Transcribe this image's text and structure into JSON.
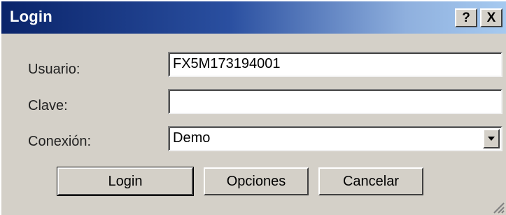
{
  "window": {
    "title": "Login",
    "help_label": "?",
    "close_label": "X"
  },
  "form": {
    "usuario_label": "Usuario:",
    "usuario_value": "FX5M173194001",
    "clave_label": "Clave:",
    "clave_value": "",
    "conexion_label": "Conexión:",
    "conexion_value": "Demo"
  },
  "buttons": {
    "login": "Login",
    "opciones": "Opciones",
    "cancelar": "Cancelar"
  },
  "colors": {
    "title_bar_start": "#0a246a",
    "title_bar_end": "#a6caf0",
    "face": "#d4d0c8"
  }
}
